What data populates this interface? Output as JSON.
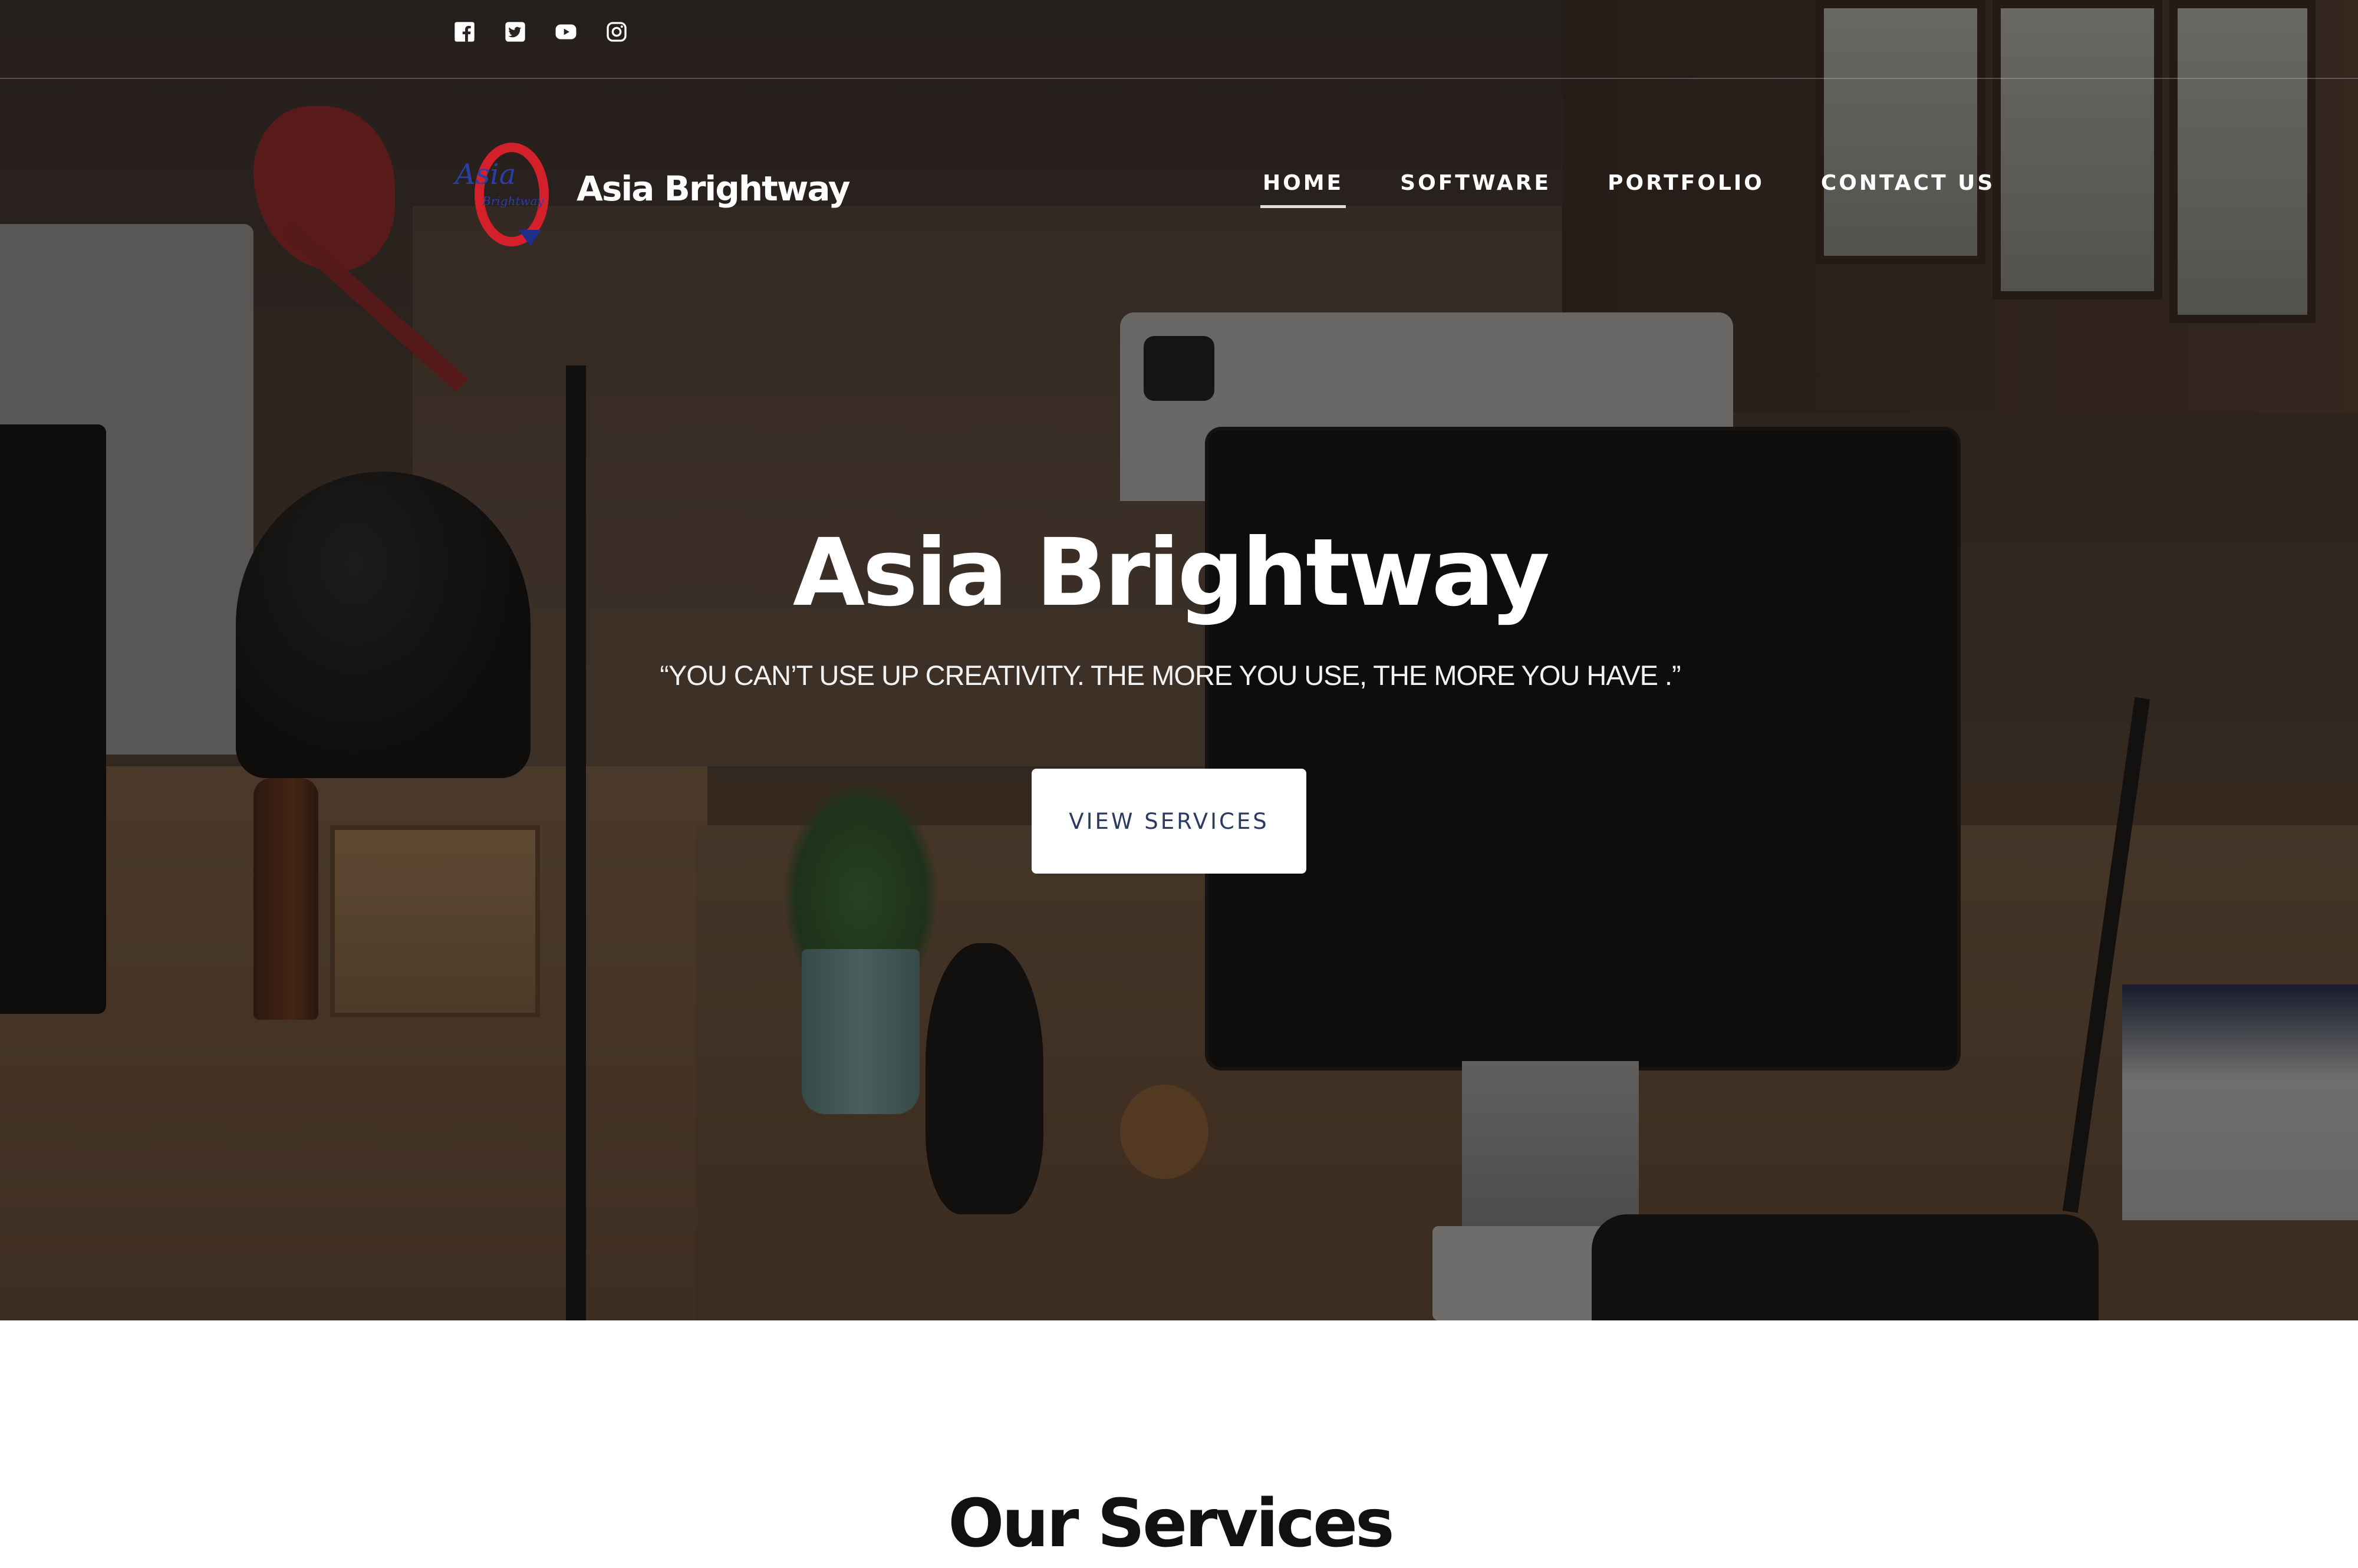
{
  "social_links": [
    {
      "icon": "facebook-icon"
    },
    {
      "icon": "twitter-icon"
    },
    {
      "icon": "youtube-icon"
    },
    {
      "icon": "instagram-icon"
    }
  ],
  "brand": {
    "logo_text": "Asia",
    "logo_subtext": "Brightway",
    "name": "Asia Brightway"
  },
  "nav": {
    "items": [
      {
        "label": "HOME",
        "active": true
      },
      {
        "label": "SOFTWARE",
        "active": false
      },
      {
        "label": "PORTFOLIO",
        "active": false
      },
      {
        "label": "CONTACT US",
        "active": false
      }
    ]
  },
  "hero": {
    "title": "Asia Brightway",
    "quote": "“YOU CAN’T USE UP CREATIVITY. THE MORE YOU USE, THE MORE YOU HAVE .”",
    "button_label": "VIEW SERVICES"
  },
  "services": {
    "title": "Our Services"
  },
  "colors": {
    "button_text": "#2a3a60",
    "logo_red": "#d4202a",
    "logo_blue": "#1e2f8a"
  }
}
